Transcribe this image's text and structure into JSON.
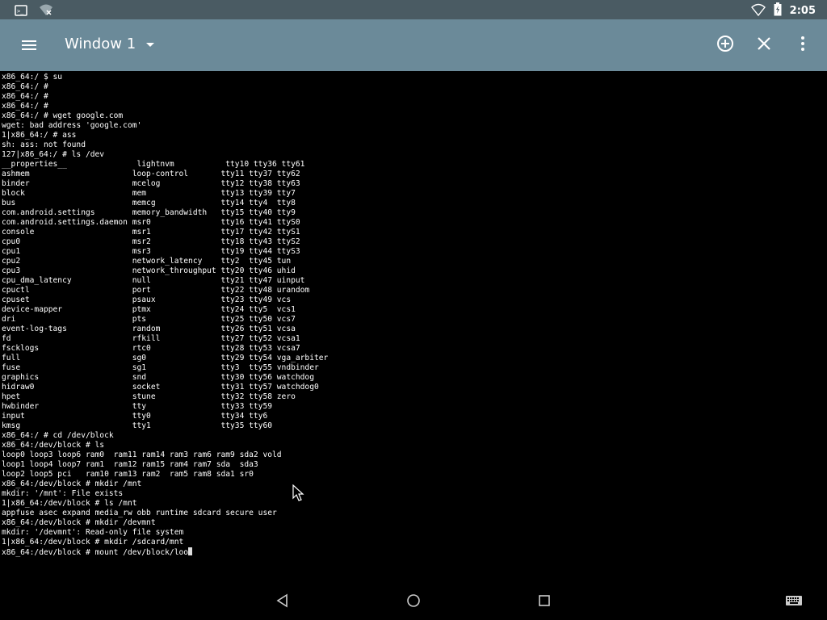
{
  "status_bar": {
    "time": "2:05",
    "icons": [
      "terminal-notification-icon",
      "wifi-signal-icon",
      "wifi-icon",
      "battery-icon"
    ]
  },
  "app_bar": {
    "title": "Window 1",
    "icons": [
      "hamburger-menu-icon",
      "dropdown-arrow-icon",
      "add-circle-icon",
      "close-icon",
      "more-vert-icon"
    ]
  },
  "terminal": {
    "lines": [
      "x86_64:/ $ su",
      "x86_64:/ #",
      "x86_64:/ #",
      "x86_64:/ #",
      "x86_64:/ # wget google.com",
      "wget: bad address 'google.com'",
      "1|x86_64:/ # ass",
      "sh: ass: not found",
      "127|x86_64:/ # ls /dev",
      "__properties__               lightnvm           tty10 tty36 tty61",
      "ashmem                      loop-control       tty11 tty37 tty62",
      "binder                      mcelog             tty12 tty38 tty63",
      "block                       mem                tty13 tty39 tty7",
      "bus                         memcg              tty14 tty4  tty8",
      "com.android.settings        memory_bandwidth   tty15 tty40 tty9",
      "com.android.settings.daemon msr0               tty16 tty41 ttyS0",
      "console                     msr1               tty17 tty42 ttyS1",
      "cpu0                        msr2               tty18 tty43 ttyS2",
      "cpu1                        msr3               tty19 tty44 ttyS3",
      "cpu2                        network_latency    tty2  tty45 tun",
      "cpu3                        network_throughput tty20 tty46 uhid",
      "cpu_dma_latency             null               tty21 tty47 uinput",
      "cpuctl                      port               tty22 tty48 urandom",
      "cpuset                      psaux              tty23 tty49 vcs",
      "device-mapper               ptmx               tty24 tty5  vcs1",
      "dri                         pts                tty25 tty50 vcs7",
      "event-log-tags              random             tty26 tty51 vcsa",
      "fd                          rfkill             tty27 tty52 vcsa1",
      "fscklogs                    rtc0               tty28 tty53 vcsa7",
      "full                        sg0                tty29 tty54 vga_arbiter",
      "fuse                        sg1                tty3  tty55 vndbinder",
      "graphics                    snd                tty30 tty56 watchdog",
      "hidraw0                     socket             tty31 tty57 watchdog0",
      "hpet                        stune              tty32 tty58 zero",
      "hwbinder                    tty                tty33 tty59",
      "input                       tty0               tty34 tty6",
      "kmsg                        tty1               tty35 tty60",
      "x86_64:/ # cd /dev/block",
      "x86_64:/dev/block # ls",
      "loop0 loop3 loop6 ram0  ram11 ram14 ram3 ram6 ram9 sda2 vold",
      "loop1 loop4 loop7 ram1  ram12 ram15 ram4 ram7 sda  sda3",
      "loop2 loop5 pci   ram10 ram13 ram2  ram5 ram8 sda1 sr0",
      "x86_64:/dev/block # mkdir /mnt",
      "mkdir: '/mnt': File exists",
      "1|x86_64:/dev/block # ls /mnt",
      "appfuse asec expand media_rw obb runtime sdcard secure user",
      "x86_64:/dev/block # mkdir /devmnt",
      "mkdir: '/devmnt': Read-only file system",
      "1|x86_64:/dev/block # mkdir /sdcard/mnt"
    ],
    "current_input": "x86_64:/dev/block # mount /dev/block/loo"
  },
  "nav_bar": {
    "icons": [
      "back-icon",
      "home-icon",
      "recents-icon",
      "keyboard-icon"
    ]
  }
}
